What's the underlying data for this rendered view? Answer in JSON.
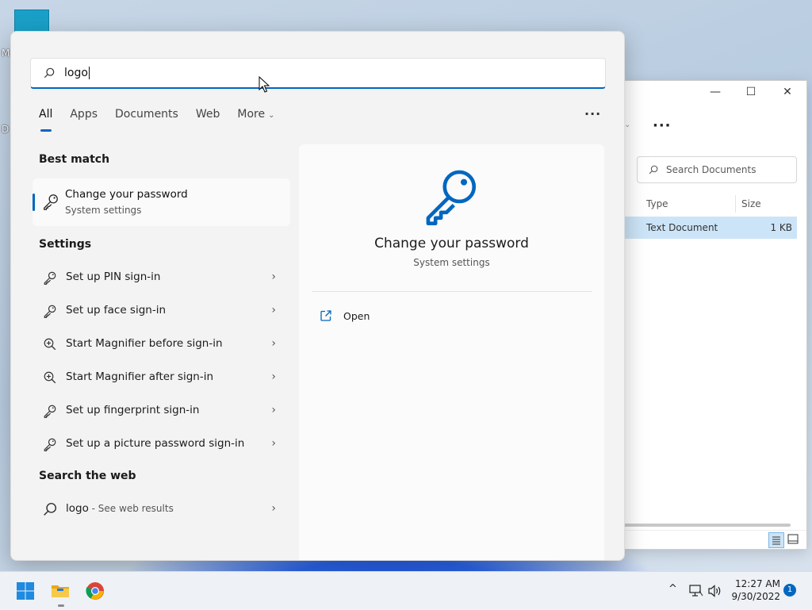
{
  "desktop": {
    "letters": [
      "M",
      "D"
    ]
  },
  "explorer": {
    "window_controls": {
      "minimize": "—",
      "maximize": "☐",
      "close": "✕"
    },
    "more_label": "···",
    "search_placeholder": "Search Documents",
    "columns": [
      "Type",
      "Size"
    ],
    "row": {
      "type": "Text Document",
      "size": "1 KB"
    }
  },
  "search": {
    "query": "logo",
    "tabs": [
      "All",
      "Apps",
      "Documents",
      "Web",
      "More"
    ],
    "more_menu": "···"
  },
  "best_match": {
    "heading": "Best match",
    "title": "Change your password",
    "subtitle": "System settings"
  },
  "settings": {
    "heading": "Settings",
    "items": [
      {
        "label": "Set up PIN sign-in",
        "icon": "key-icon"
      },
      {
        "label": "Set up face sign-in",
        "icon": "key-icon"
      },
      {
        "label": "Start Magnifier before sign-in",
        "icon": "magnifier-icon"
      },
      {
        "label": "Start Magnifier after sign-in",
        "icon": "magnifier-icon"
      },
      {
        "label": "Set up fingerprint sign-in",
        "icon": "key-icon"
      },
      {
        "label": "Set up a picture password sign-in",
        "icon": "key-icon"
      }
    ]
  },
  "web": {
    "heading": "Search the web",
    "query": "logo",
    "suffix": " - See web results"
  },
  "preview": {
    "title": "Change your password",
    "subtitle": "System settings",
    "open_label": "Open"
  },
  "taskbar": {
    "time": "12:27 AM",
    "date": "9/30/2022",
    "notifications": "1"
  },
  "colors": {
    "accent": "#0067c0"
  }
}
